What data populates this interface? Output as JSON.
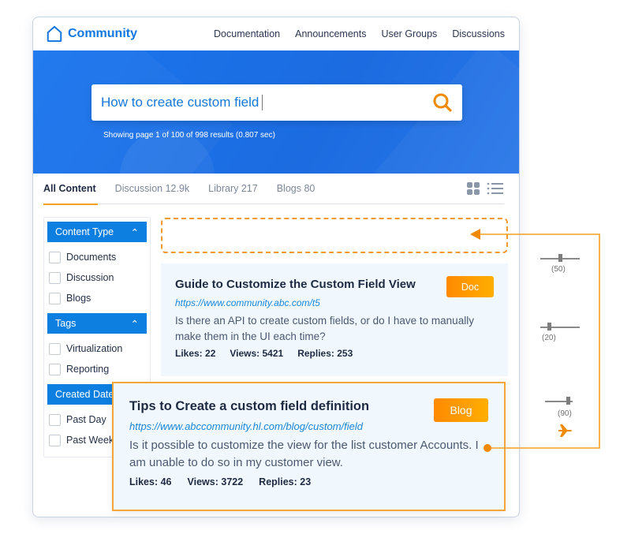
{
  "app": {
    "title": "Community",
    "icon": "home-icon"
  },
  "nav": [
    "Documentation",
    "Announcements",
    "User Groups",
    "Discussions"
  ],
  "search": {
    "value": "How to create custom field",
    "icon": "search-icon"
  },
  "results_info": "Showing page 1 of 100 of 998 results (0.807 sec)",
  "tabs": [
    {
      "label": "All Content",
      "active": true
    },
    {
      "label": "Discussion 12.9k",
      "active": false
    },
    {
      "label": "Library 217",
      "active": false
    },
    {
      "label": "Blogs 80",
      "active": false
    }
  ],
  "view_icons": [
    "grid-view-icon",
    "list-view-icon"
  ],
  "filters": [
    {
      "title": "Content Type",
      "items": [
        "Documents",
        "Discussion",
        "Blogs"
      ]
    },
    {
      "title": "Tags",
      "items": [
        "Virtualization",
        "Reporting"
      ]
    },
    {
      "title": "Created Date",
      "items": [
        "Past Day",
        "Past Week"
      ]
    }
  ],
  "results": [
    {
      "title": "Guide to Customize the Custom Field View",
      "badge": "Doc",
      "url": "https://www.community.abc.com/t5",
      "description": "Is there an API to create custom fields, or do I have to manually make them in the UI each time?",
      "likes": "Likes: 22",
      "views": "Views: 5421",
      "replies": "Replies: 253"
    },
    {
      "title": "Tips to Create a custom field definition",
      "badge": "Blog",
      "url": "https://www.abccommunity.hl.com/blog/custom/field",
      "description": "Is it possible to customize the view for the list customer Accounts. I am unable to do so in my customer view.",
      "likes": "Likes: 46",
      "views": "Views: 3722",
      "replies": "Replies: 23"
    }
  ],
  "sliders": [
    {
      "value": 50,
      "label": "(50)"
    },
    {
      "value": 20,
      "label": "(20)"
    },
    {
      "value": 90,
      "label": "(90)"
    }
  ],
  "colors": {
    "brand": "#1477e0",
    "accent": "#f4a021",
    "hero": "#1a76ee"
  },
  "side_icon": "airplane-icon"
}
